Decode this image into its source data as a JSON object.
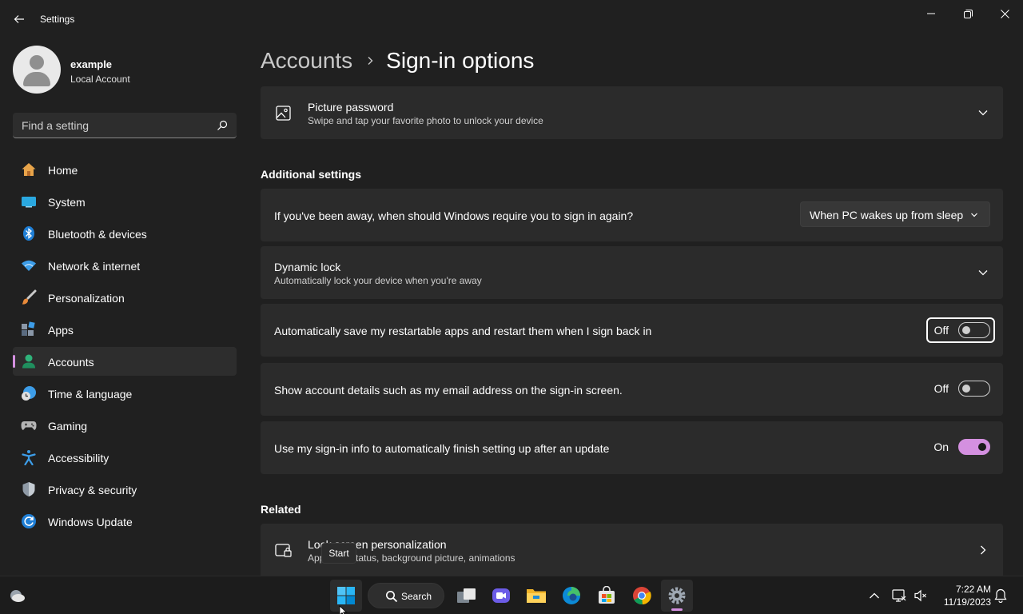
{
  "window": {
    "app_title": "Settings"
  },
  "profile": {
    "name": "example",
    "account_type": "Local Account"
  },
  "search": {
    "placeholder": "Find a setting"
  },
  "nav": {
    "items": [
      {
        "label": "Home",
        "icon": "home-icon"
      },
      {
        "label": "System",
        "icon": "system-icon"
      },
      {
        "label": "Bluetooth & devices",
        "icon": "bluetooth-icon"
      },
      {
        "label": "Network & internet",
        "icon": "wifi-icon"
      },
      {
        "label": "Personalization",
        "icon": "brush-icon"
      },
      {
        "label": "Apps",
        "icon": "apps-icon"
      },
      {
        "label": "Accounts",
        "icon": "accounts-icon",
        "active": true
      },
      {
        "label": "Time & language",
        "icon": "clock-globe-icon"
      },
      {
        "label": "Gaming",
        "icon": "gamepad-icon"
      },
      {
        "label": "Accessibility",
        "icon": "accessibility-icon"
      },
      {
        "label": "Privacy & security",
        "icon": "shield-icon"
      },
      {
        "label": "Windows Update",
        "icon": "update-icon"
      }
    ]
  },
  "breadcrumb": {
    "parent": "Accounts",
    "current": "Sign-in options"
  },
  "picture_password": {
    "title": "Picture password",
    "subtitle": "Swipe and tap your favorite photo to unlock your device"
  },
  "additional": {
    "heading": "Additional settings",
    "away_question": "If you've been away, when should Windows require you to sign in again?",
    "away_selected": "When PC wakes up from sleep",
    "dynamic_lock_title": "Dynamic lock",
    "dynamic_lock_subtitle": "Automatically lock your device when you're away",
    "restart_apps_label": "Automatically save my restartable apps and restart them when I sign back in",
    "restart_apps_state": "Off",
    "account_details_label": "Show account details such as my email address on the sign-in screen.",
    "account_details_state": "Off",
    "signin_info_label": "Use my sign-in info to automatically finish setting up after an update",
    "signin_info_state": "On"
  },
  "related": {
    "heading": "Related",
    "lock_title": "Lock screen personalization",
    "lock_subtitle": "Apps and status, background picture, animations"
  },
  "tooltip": {
    "text": "Start"
  },
  "taskbar": {
    "search_label": "Search",
    "time": "7:22 AM",
    "date": "11/19/2023"
  },
  "colors": {
    "accent": "#d490e0",
    "background": "#202020",
    "card": "#2b2b2b"
  }
}
